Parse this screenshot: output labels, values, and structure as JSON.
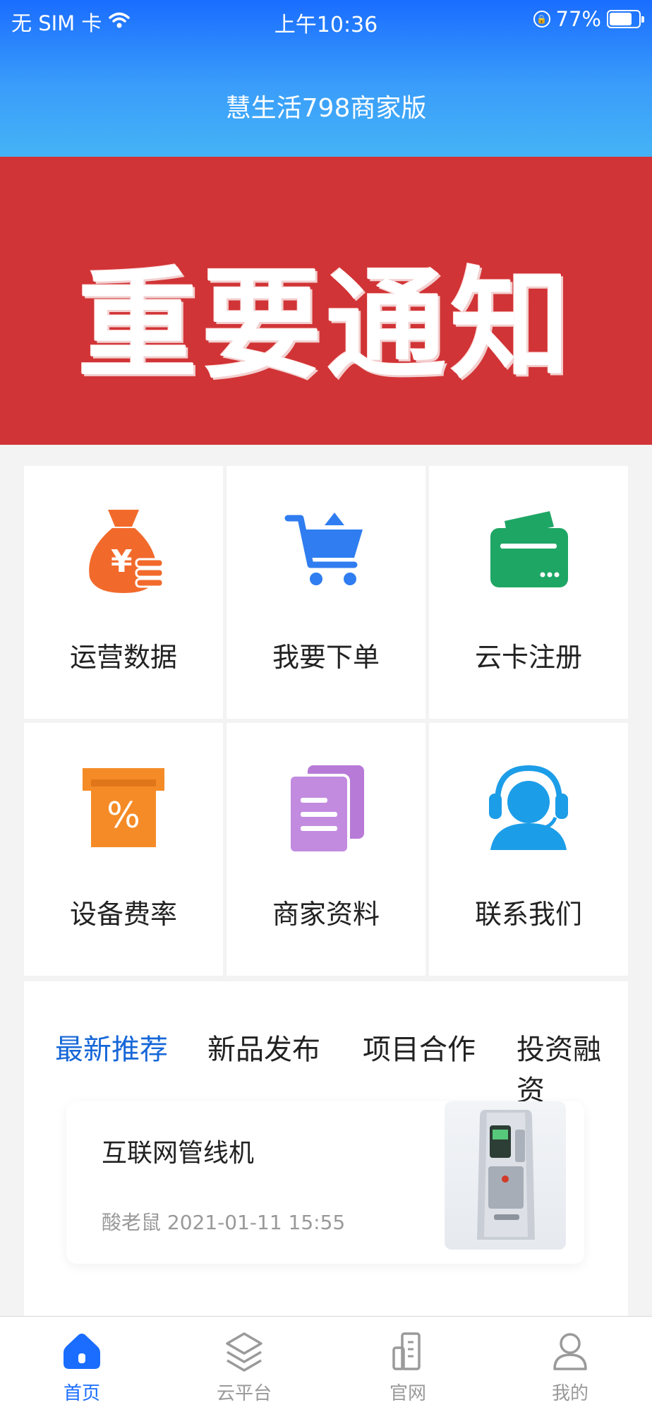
{
  "status_bar": {
    "carrier": "无 SIM 卡",
    "time": "上午10:36",
    "battery_percent": "77%",
    "battery_level": 0.77
  },
  "header": {
    "title": "慧生活798商家版"
  },
  "banner": {
    "text": "重要通知",
    "background": "#d13436",
    "pagination_count": 1,
    "pagination_active": 0
  },
  "grid": {
    "items": [
      {
        "label": "运营数据",
        "icon": "money-bag-icon",
        "color": "#f26a2b"
      },
      {
        "label": "我要下单",
        "icon": "cart-icon",
        "color": "#2f7df0"
      },
      {
        "label": "云卡注册",
        "icon": "card-icon",
        "color": "#1ea665"
      },
      {
        "label": "设备费率",
        "icon": "rate-icon",
        "color": "#f58b26"
      },
      {
        "label": "商家资料",
        "icon": "documents-icon",
        "color": "#b77ad6"
      },
      {
        "label": "联系我们",
        "icon": "customer-service-icon",
        "color": "#1c9de8"
      }
    ]
  },
  "news": {
    "tabs": [
      "最新推荐",
      "新品发布",
      "项目合作",
      "投资融资"
    ],
    "active_tab": 0,
    "articles": [
      {
        "title": "互联网管线机",
        "author": "酸老鼠",
        "date": "2021-01-11 15:55"
      }
    ]
  },
  "bottom_nav": {
    "items": [
      {
        "label": "首页",
        "icon": "home-icon",
        "active": true
      },
      {
        "label": "云平台",
        "icon": "layers-icon",
        "active": false
      },
      {
        "label": "官网",
        "icon": "building-icon",
        "active": false
      },
      {
        "label": "我的",
        "icon": "user-icon",
        "active": false
      }
    ]
  },
  "colors": {
    "accent": "#1a6dff",
    "tab_active": "#1667d8"
  }
}
